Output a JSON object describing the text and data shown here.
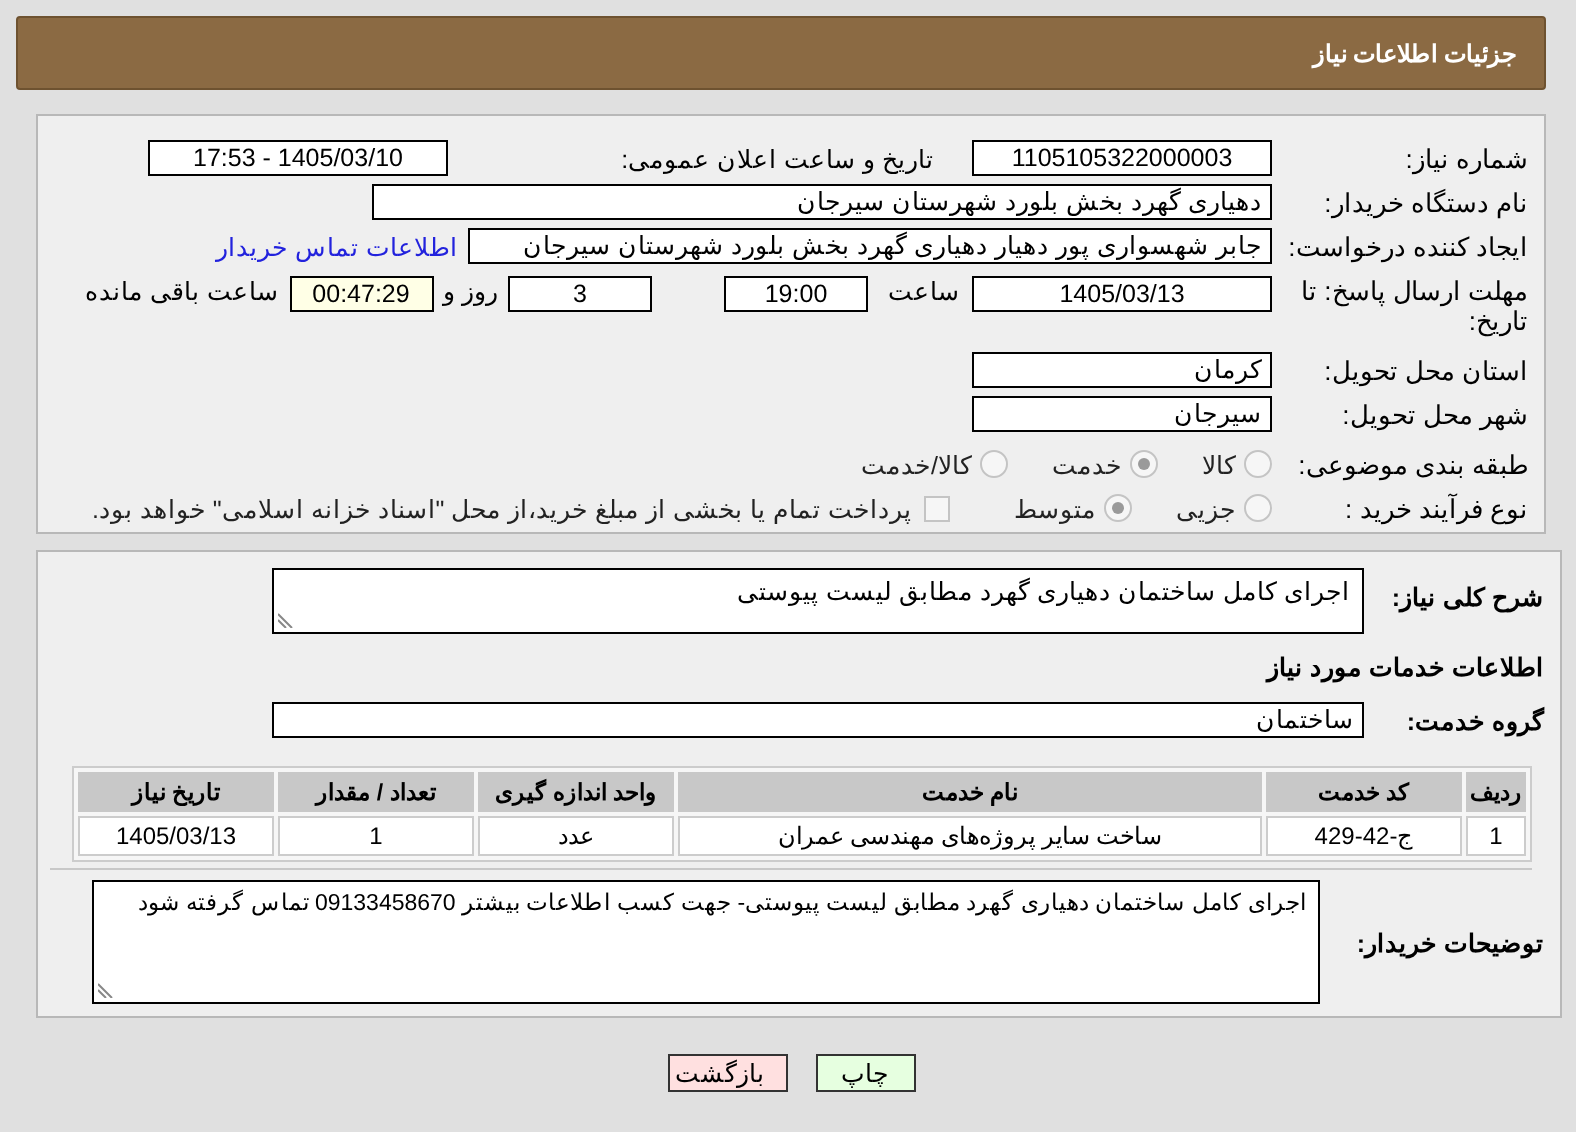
{
  "header": {
    "title": "جزئیات اطلاعات نیاز"
  },
  "details": {
    "need_number": {
      "label": "شماره نیاز:",
      "value": "1105105322000003"
    },
    "announce": {
      "label": "تاریخ و ساعت اعلان عمومی:",
      "value": "1405/03/10 - 17:53"
    },
    "buyer_org": {
      "label": "نام دستگاه خریدار:",
      "value": "دهیاری گهرد بخش بلورد شهرستان سیرجان"
    },
    "requester": {
      "label": "ایجاد کننده درخواست:",
      "value": "جابر شهسواری پور دهیار دهیاری گهرد بخش بلورد شهرستان سیرجان",
      "link": "اطلاعات تماس خریدار"
    },
    "deadline": {
      "label": "مهلت ارسال پاسخ: تا تاریخ:",
      "date": "1405/03/13",
      "time_label": "ساعت",
      "time": "19:00",
      "days": "3",
      "days_label": "روز و",
      "remaining": "00:47:29",
      "remaining_label": "ساعت باقی مانده"
    },
    "province": {
      "label": "استان محل تحویل:",
      "value": "کرمان"
    },
    "city": {
      "label": "شهر محل تحویل:",
      "value": "سیرجان"
    },
    "category": {
      "label": "طبقه بندی موضوعی:",
      "options": [
        {
          "label": "کالا",
          "selected": false
        },
        {
          "label": "خدمت",
          "selected": true
        },
        {
          "label": "کالا/خدمت",
          "selected": false
        }
      ]
    },
    "process": {
      "label": "نوع فرآیند خرید :",
      "options": [
        {
          "label": "جزیی",
          "selected": false
        },
        {
          "label": "متوسط",
          "selected": true
        }
      ],
      "payment": {
        "checked": false,
        "label": "پرداخت تمام یا بخشی از مبلغ خرید،از محل \"اسناد خزانه اسلامی\" خواهد بود."
      }
    }
  },
  "summary": {
    "label": "شرح کلی نیاز:",
    "value": "اجرای کامل ساختمان دهیاری گهرد مطابق لیست پیوستی"
  },
  "services": {
    "title": "اطلاعات خدمات مورد نیاز",
    "group_label": "گروه خدمت:",
    "group": "ساختمان",
    "table": {
      "columns": [
        "ردیف",
        "کد خدمت",
        "نام خدمت",
        "واحد اندازه گیری",
        "تعداد / مقدار",
        "تاریخ نیاز"
      ],
      "rows": [
        [
          "1",
          "ج-42-429",
          "ساخت سایر پروژه‌های مهندسی عمران",
          "عدد",
          "1",
          "1405/03/13"
        ]
      ]
    }
  },
  "buyer_notes": {
    "label": "توضیحات خریدار:",
    "value": "اجرای کامل ساختمان دهیاری گهرد مطابق لیست پیوستی- جهت کسب اطلاعات بیشتر 09133458670 تماس گرفته شود"
  },
  "buttons": [
    {
      "label": "چاپ",
      "kind": "print"
    },
    {
      "label": "بازگشت",
      "kind": "back"
    }
  ]
}
